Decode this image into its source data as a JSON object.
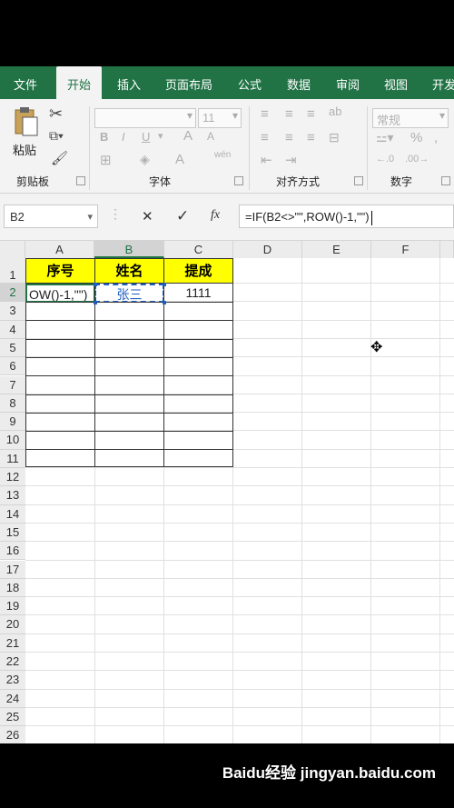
{
  "tabs": [
    "文件",
    "开始",
    "插入",
    "页面布局",
    "公式",
    "数据",
    "审阅",
    "视图",
    "开发"
  ],
  "active_tab": "开始",
  "ribbon": {
    "clipboard": {
      "paste_label": "粘贴",
      "group_label": "剪贴板"
    },
    "font": {
      "font_size": "11",
      "bold": "B",
      "italic": "I",
      "underline": "U",
      "grow": "A",
      "shrink": "A",
      "wen": "wén",
      "color_letter": "A",
      "group_label": "字体"
    },
    "alignment": {
      "group_label": "对齐方式"
    },
    "number": {
      "format": "常规",
      "percent": "%",
      "group_label": "数字"
    }
  },
  "formula_bar": {
    "name_box": "B2",
    "cancel": "✕",
    "enter": "✓",
    "fx": "fx",
    "formula": "=IF(B2<>\"\",ROW()-1,\"\")"
  },
  "columns": [
    "A",
    "B",
    "C",
    "D",
    "E",
    "F"
  ],
  "rows": [
    "1",
    "2",
    "3",
    "4",
    "5",
    "6",
    "7",
    "8",
    "9",
    "10",
    "11",
    "12",
    "13",
    "14",
    "15",
    "16",
    "17",
    "18",
    "19",
    "20",
    "21",
    "22",
    "23",
    "24",
    "25",
    "26"
  ],
  "cells": {
    "A1": "序号",
    "B1": "姓名",
    "C1": "提成",
    "A2": "OW()-1,\"\")",
    "B2": "张三",
    "C2": "1111"
  },
  "colors": {
    "excel_green": "#217346",
    "header_fill": "#FFFF00",
    "cell_ref": "#1f5fbf"
  },
  "watermark": "Baidu经验 jingyan.baidu.com"
}
